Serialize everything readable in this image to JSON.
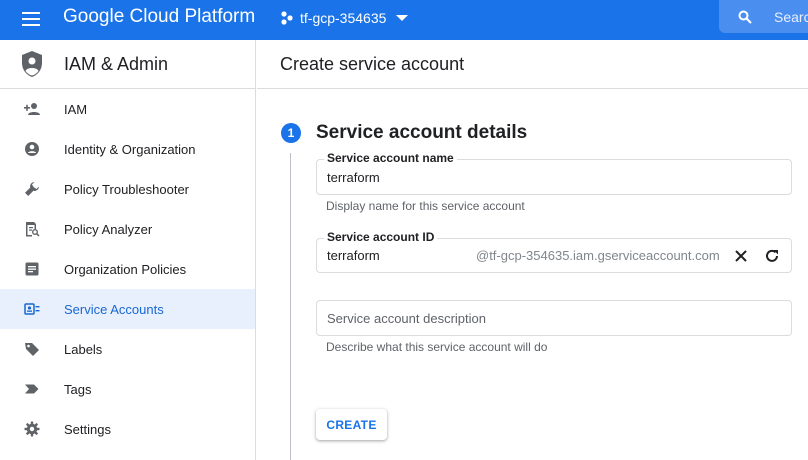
{
  "topbar": {
    "app_title": "Google Cloud Platform",
    "project_name": "tf-gcp-354635",
    "search_placeholder": "Search",
    "brand_color": "#1a73e8"
  },
  "sidebar": {
    "title": "IAM & Admin",
    "items": [
      {
        "label": "IAM",
        "icon": "person-add-icon"
      },
      {
        "label": "Identity & Organization",
        "icon": "account-circle-icon"
      },
      {
        "label": "Policy Troubleshooter",
        "icon": "wrench-icon"
      },
      {
        "label": "Policy Analyzer",
        "icon": "document-search-icon"
      },
      {
        "label": "Organization Policies",
        "icon": "list-doc-icon"
      },
      {
        "label": "Service Accounts",
        "icon": "service-account-icon",
        "active": true
      },
      {
        "label": "Labels",
        "icon": "label-icon"
      },
      {
        "label": "Tags",
        "icon": "tag-icon"
      },
      {
        "label": "Settings",
        "icon": "gear-icon"
      }
    ]
  },
  "main": {
    "page_title": "Create service account",
    "step": {
      "number": "1",
      "title": "Service account details"
    },
    "fields": {
      "name": {
        "label": "Service account name",
        "value": "terraform",
        "hint": "Display name for this service account"
      },
      "id": {
        "label": "Service account ID",
        "value": "terraform",
        "suffix": "@tf-gcp-354635.iam.gserviceaccount.com"
      },
      "description": {
        "placeholder": "Service account description",
        "hint": "Describe what this service account will do"
      }
    },
    "create_label": "CREATE"
  }
}
